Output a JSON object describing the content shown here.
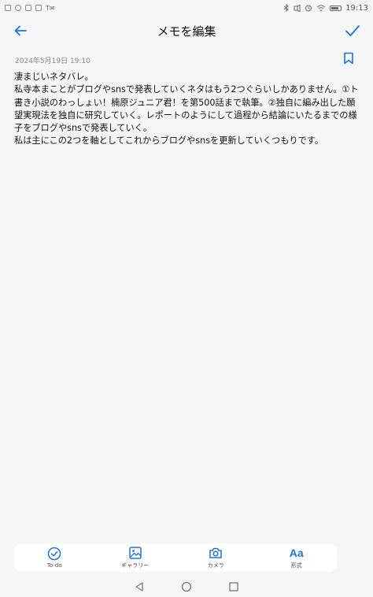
{
  "status_bar": {
    "left_icons": [
      "app-notification-icon",
      "app-notification-icon",
      "app-notification-icon",
      "app-notification-icon"
    ],
    "left_small_text": "T✉",
    "right_icons": [
      "bluetooth-icon",
      "silent-icon",
      "alarm-icon",
      "wifi-icon",
      "battery-icon"
    ],
    "time": "19:13"
  },
  "header": {
    "title": "メモを編集",
    "back_icon": "arrow-left-icon",
    "confirm_icon": "checkmark-icon",
    "accent_color": "#1e74d4"
  },
  "note": {
    "timestamp": "2024年5月19日 19:10",
    "bookmark_icon": "bookmark-icon",
    "paragraphs": [
      "凄まじいネタバレ。",
      "私寺本まことがブログやsnsで発表していくネタはもう2つぐらいしかありません。①ト書き小説のわっしょい！楠原ジュニア君！を第500話まで執筆。②独自に編み出した願望実現法を独自に研究していく。レポートのようにして過程から結論にいたるまでの様子をブログやsnsで発表していく。",
      "私は主にこの2つを軸としてこれからブログやsnsを更新していくつもりです。"
    ]
  },
  "toolbar": {
    "items": [
      {
        "label": "To-do",
        "icon": "todo-check-icon"
      },
      {
        "label": "ギャラリー",
        "icon": "gallery-icon"
      },
      {
        "label": "カメラ",
        "icon": "camera-icon"
      },
      {
        "label": "形式",
        "icon": "text-format-icon",
        "glyph": "Aa"
      }
    ]
  },
  "nav_bar": {
    "icons": [
      "back-triangle-icon",
      "home-circle-icon",
      "recents-square-icon"
    ]
  }
}
